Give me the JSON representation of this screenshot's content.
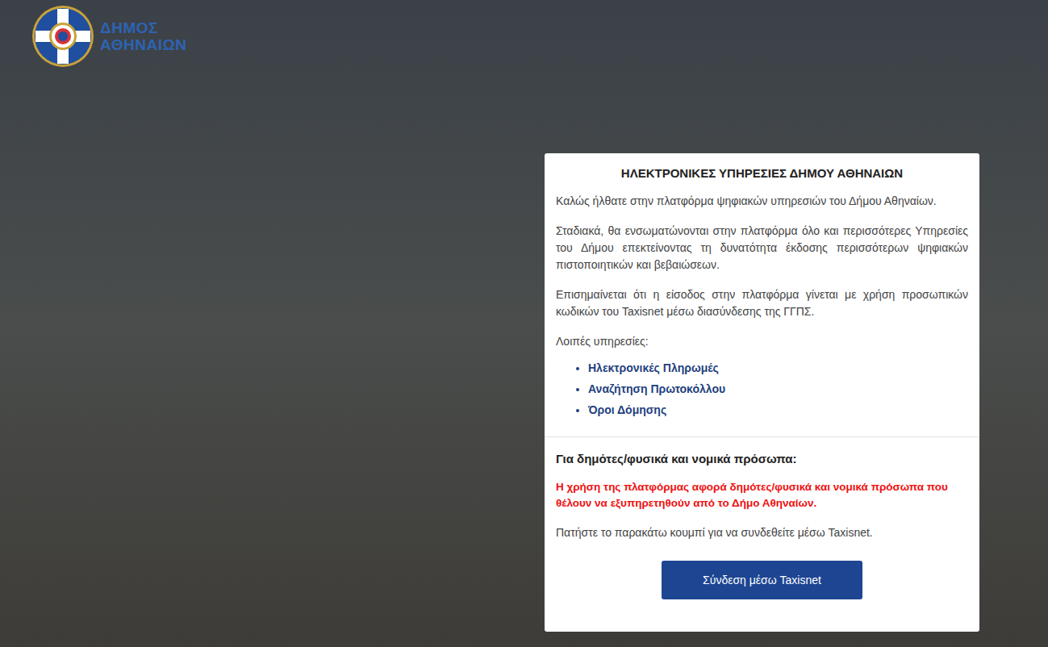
{
  "logo": {
    "lines": [
      "ΔΗΜΟΣ",
      "ΑΘΗΝΑΙΩΝ"
    ]
  },
  "card": {
    "title": "ΗΛΕΚΤΡΟΝΙΚΕΣ ΥΠΗΡΕΣΙΕΣ ΔΗΜΟΥ ΑΘΗΝΑΙΩΝ",
    "paragraphs": [
      "Καλώς ήλθατε στην πλατφόρμα ψηφιακών υπηρεσιών του Δήμου Αθηναίων.",
      "Σταδιακά, θα ενσωματώνονται στην πλατφόρμα όλο και περισσότερες Υπηρεσίες του Δήμου επεκτείνοντας τη δυνατότητα έκδοσης περισσότερων ψηφιακών πιστοποιητικών και βεβαιώσεων.",
      "Επισημαίνεται ότι η είσοδος στην πλατφόρμα γίνεται με χρήση προσωπικών κωδικών του Taxisnet μέσω διασύνδεσης της ΓΓΠΣ."
    ],
    "other_services_label": "Λοιπές υπηρεσίες:",
    "links": [
      "Ηλεκτρονικές Πληρωμές",
      "Αναζήτηση Πρωτοκόλλου",
      "Όροι Δόμησης"
    ]
  },
  "login_section": {
    "heading": "Για δημότες/φυσικά και νομικά πρόσωπα:",
    "notice": "Η χρήση της πλατφόρμας αφορά δημότες/φυσικά και νομικά πρόσωπα που θέλουν να εξυπηρετηθούν από το Δήμο Αθηναίων.",
    "instruction": "Πατήστε το παρακάτω κουμπί για να συνδεθείτε μέσω Taxisnet.",
    "button": "Σύνδεση μέσω Taxisnet"
  }
}
